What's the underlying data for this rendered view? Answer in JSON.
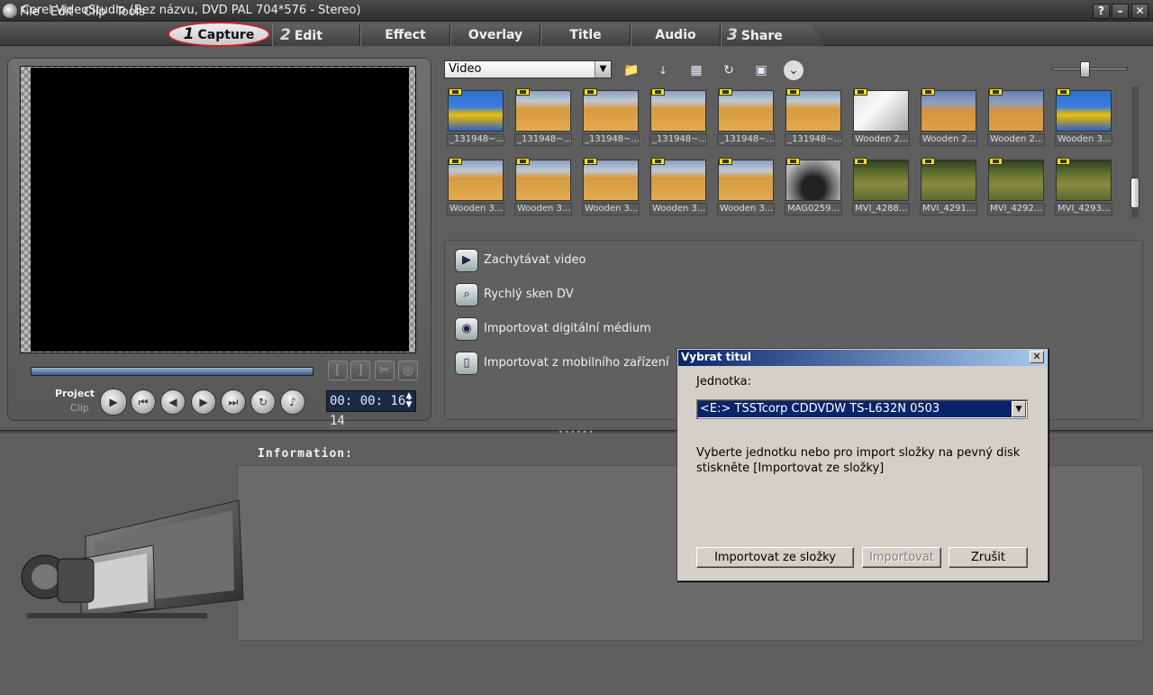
{
  "window": {
    "title": "Corel VideoStudio (Bez názvu, DVD PAL 704*576 - Stereo)",
    "controls": [
      "?",
      "–",
      "✕"
    ]
  },
  "menu": [
    "File",
    "Edit",
    "Clip",
    "Tools"
  ],
  "steps": [
    {
      "num": "1",
      "label": "Capture",
      "active": true
    },
    {
      "num": "2",
      "label": "Edit"
    },
    {
      "num": "",
      "label": "Effect"
    },
    {
      "num": "",
      "label": "Overlay"
    },
    {
      "num": "",
      "label": "Title"
    },
    {
      "num": "",
      "label": "Audio"
    },
    {
      "num": "3",
      "label": "Share"
    }
  ],
  "player": {
    "project_label": "Project",
    "clip_label": "Clip",
    "timecode": "00:00:16:14",
    "timecode_display": "00: 00: 16: 14"
  },
  "library": {
    "category": "Video",
    "thumbnails": [
      {
        "caption": "_131948~...",
        "kind": "ring"
      },
      {
        "caption": "_131948~...",
        "kind": "court"
      },
      {
        "caption": "_131948~...",
        "kind": "court"
      },
      {
        "caption": "_131948~...",
        "kind": "court"
      },
      {
        "caption": "_131948~...",
        "kind": "court"
      },
      {
        "caption": "_131948~...",
        "kind": "court"
      },
      {
        "caption": "Wooden 2...",
        "kind": "paper"
      },
      {
        "caption": "Wooden 2...",
        "kind": "court2"
      },
      {
        "caption": "Wooden 2...",
        "kind": "court2"
      },
      {
        "caption": "Wooden 3...",
        "kind": "ring"
      },
      {
        "caption": "Wooden 3...",
        "kind": "court"
      },
      {
        "caption": "Wooden 3...",
        "kind": "court"
      },
      {
        "caption": "Wooden 3...",
        "kind": "court"
      },
      {
        "caption": "Wooden 3...",
        "kind": "court"
      },
      {
        "caption": "Wooden 3...",
        "kind": "court"
      },
      {
        "caption": "MAG0259...",
        "kind": "tramp"
      },
      {
        "caption": "MVI_4288...",
        "kind": "gym"
      },
      {
        "caption": "MVI_4291...",
        "kind": "gym"
      },
      {
        "caption": "MVI_4292...",
        "kind": "gym"
      },
      {
        "caption": "MVI_4293...",
        "kind": "gym"
      }
    ]
  },
  "capture_options": [
    {
      "label": "Zachytávat video",
      "icon": "camcorder-icon",
      "glyph": "▶"
    },
    {
      "label": "Rychlý sken DV",
      "icon": "dv-scan-icon",
      "glyph": "⌕"
    },
    {
      "label": "Importovat digitální médium",
      "icon": "disc-import-icon",
      "glyph": "◉"
    },
    {
      "label": "Importovat z mobilního zařízení",
      "icon": "mobile-device-icon",
      "glyph": "▯"
    }
  ],
  "information_label": "Information:",
  "dialog": {
    "title": "Vybrat titul",
    "drive_label": "Jednotka:",
    "drive_value": "<E:>  TSSTcorp CDDVDW TS-L632N 0503",
    "message": "Vyberte jednotku nebo pro import složky na pevný disk stiskněte [Importovat ze složky]",
    "buttons": {
      "import_folder": "Importovat ze složky",
      "import": "Importovat",
      "cancel": "Zrušit"
    }
  }
}
